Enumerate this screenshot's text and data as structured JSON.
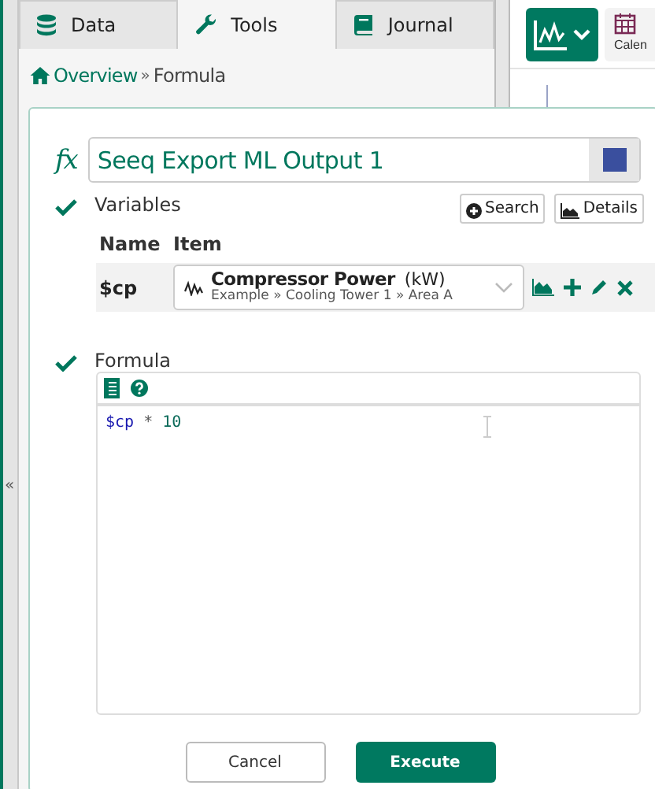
{
  "tabs": [
    {
      "label": "Data",
      "selected": false
    },
    {
      "label": "Tools",
      "selected": true
    },
    {
      "label": "Journal",
      "selected": false
    }
  ],
  "collapse_toggle": "«",
  "breadcrumb": {
    "items": [
      "Overview",
      "Formula"
    ],
    "separator": "»"
  },
  "toolbar": {
    "calendar_label": "Calen"
  },
  "formula_tool": {
    "symbol": "fx",
    "name": "Seeq Export ML Output 1",
    "color": "#3a4f9e",
    "variables": {
      "label": "Variables",
      "valid": true,
      "buttons": [
        "Search",
        "Details"
      ],
      "columns": [
        "Name",
        "Item"
      ],
      "rows": [
        {
          "name": "$cp",
          "item": "Compressor Power",
          "unit": "(kW)",
          "path": "Example » Cooling Tower 1 » Area A"
        }
      ]
    },
    "formula": {
      "label": "Formula",
      "valid": true,
      "tokens": [
        {
          "text": "$cp",
          "kind": "variable"
        },
        {
          "text": " * ",
          "kind": "operator"
        },
        {
          "text": "10",
          "kind": "number"
        }
      ]
    },
    "buttons": [
      "Cancel",
      "Execute"
    ]
  }
}
